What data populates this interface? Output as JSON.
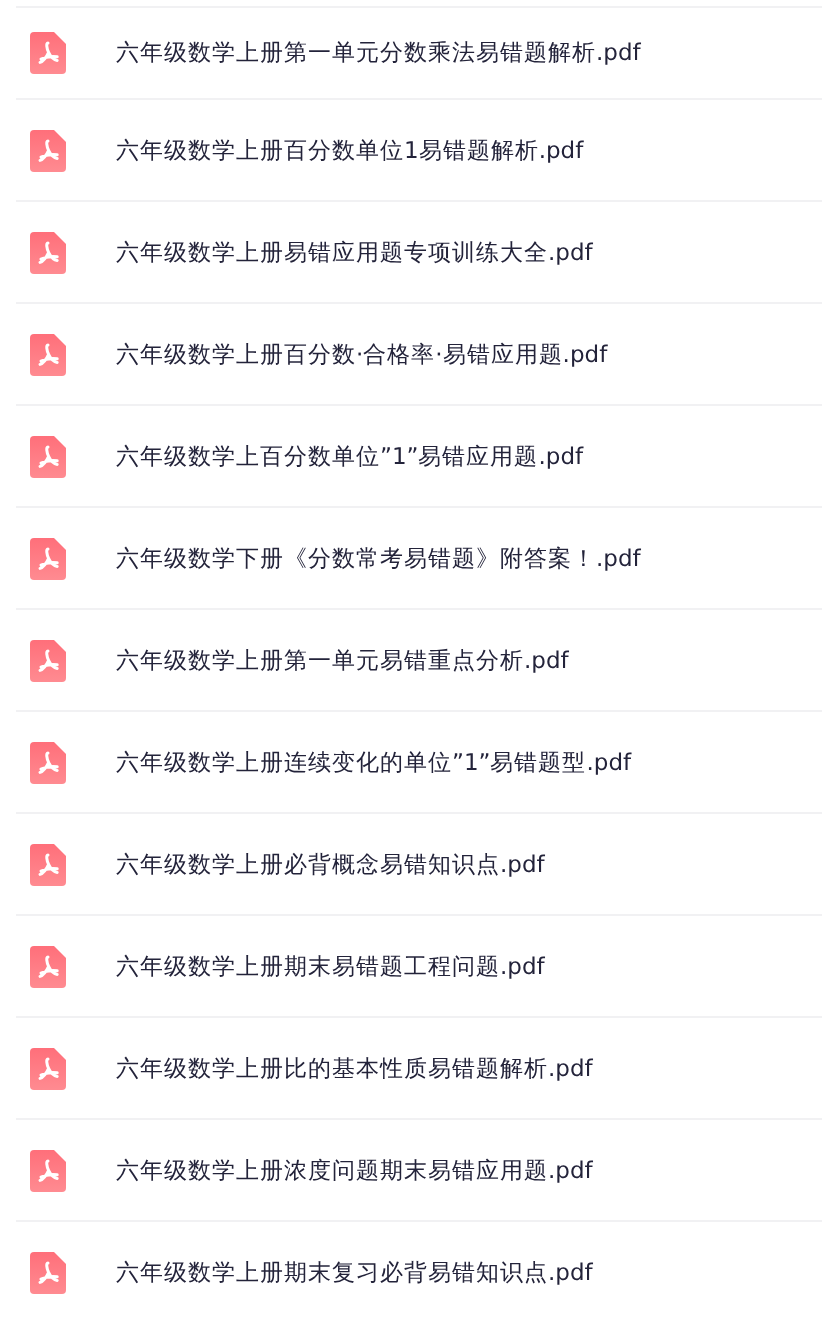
{
  "files": [
    {
      "name": "六年级数学上册第一单元分数乘法易错题解析.pdf"
    },
    {
      "name": "六年级数学上册百分数单位1易错题解析.pdf"
    },
    {
      "name": "六年级数学上册易错应用题专项训练大全.pdf"
    },
    {
      "name": "六年级数学上册百分数·合格率·易错应用题.pdf"
    },
    {
      "name": "六年级数学上百分数单位”1”易错应用题.pdf"
    },
    {
      "name": "六年级数学下册《分数常考易错题》附答案！.pdf"
    },
    {
      "name": "六年级数学上册第一单元易错重点分析.pdf"
    },
    {
      "name": "六年级数学上册连续变化的单位”1”易错题型.pdf"
    },
    {
      "name": "六年级数学上册必背概念易错知识点.pdf"
    },
    {
      "name": "六年级数学上册期末易错题工程问题.pdf"
    },
    {
      "name": "六年级数学上册比的基本性质易错题解析.pdf"
    },
    {
      "name": "六年级数学上册浓度问题期末易错应用题.pdf"
    },
    {
      "name": "六年级数学上册期末复习必背易错知识点.pdf"
    }
  ]
}
